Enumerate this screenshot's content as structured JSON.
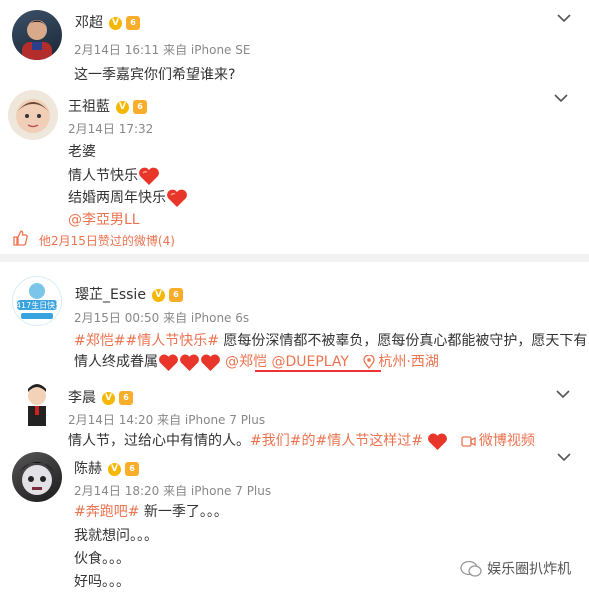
{
  "posts": [
    {
      "name": "邓超",
      "meta": "2月14日 16:11 来自 iPhone SE",
      "lines": [
        "这一季嘉宾你们希望谁来?"
      ]
    },
    {
      "name": "王祖藍",
      "meta": "2月14日 17:32",
      "lines": [
        "老婆",
        "情人节快乐",
        "结婚两周年快乐"
      ],
      "mention": "@李亞男LL",
      "like_text": "他2月15日赞过的微博(4)"
    },
    {
      "name": "璎芷_Essie",
      "meta": "2月15日 00:50 来自 iPhone 6s",
      "line1_tags": "#郑恺##情人节快乐#",
      "line1_text": " 愿每份深情都不被辜负，愿每份真心都能被守护，愿天下有",
      "line2_text": "情人终成眷属",
      "mentions": "@郑恺 @DUEPLAY",
      "location": "杭州·西湖",
      "avatar_text": "0417生日快乐"
    },
    {
      "name": "李晨",
      "meta": "2月14日 14:20 来自 iPhone 7 Plus",
      "text_a": "情人节，过给心中有情的人。",
      "tags": "#我们#的#情人节这样过#",
      "video": "微博视频"
    },
    {
      "name": "陈赫",
      "meta": "2月14日 18:20 来自 iPhone 7 Plus",
      "tag": "#奔跑吧#",
      "line1_rest": " 新一季了。。。",
      "lines": [
        "我就想问。。。",
        "伙食。。。",
        "好吗。。。"
      ]
    }
  ],
  "watermark": "娱乐圈扒炸机",
  "colors": {
    "link": "#eb7350",
    "heart": "#e8372a",
    "badge": "#f6b700",
    "underline": "#e33"
  }
}
